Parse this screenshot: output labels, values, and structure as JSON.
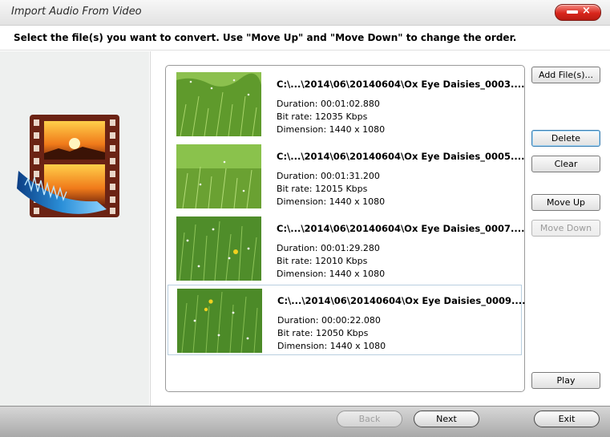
{
  "window": {
    "title": "Import Audio From Video"
  },
  "instruction": "Select the file(s) you want to convert. Use \"Move Up\" and \"Move Down\" to change the order.",
  "files": [
    {
      "name": "C:\\...\\2014\\06\\20140604\\Ox Eye Daisies_0003....",
      "duration": "Duration: 00:01:02.880",
      "bitrate": "Bit rate: 12035 Kbps",
      "dimension": "Dimension: 1440 x 1080"
    },
    {
      "name": "C:\\...\\2014\\06\\20140604\\Ox Eye Daisies_0005....",
      "duration": "Duration: 00:01:31.200",
      "bitrate": "Bit rate: 12015 Kbps",
      "dimension": "Dimension: 1440 x 1080"
    },
    {
      "name": "C:\\...\\2014\\06\\20140604\\Ox Eye Daisies_0007....",
      "duration": "Duration: 00:01:29.280",
      "bitrate": "Bit rate: 12010 Kbps",
      "dimension": "Dimension: 1440 x 1080"
    },
    {
      "name": "C:\\...\\2014\\06\\20140604\\Ox Eye Daisies_0009....",
      "duration": "Duration: 00:00:22.080",
      "bitrate": "Bit rate: 12050 Kbps",
      "dimension": "Dimension: 1440 x 1080"
    }
  ],
  "buttons": {
    "add_files": "Add File(s)...",
    "delete": "Delete",
    "clear": "Clear",
    "move_up": "Move Up",
    "move_down": "Move Down",
    "play": "Play"
  },
  "footer": {
    "back": "Back",
    "next": "Next",
    "exit": "Exit"
  }
}
